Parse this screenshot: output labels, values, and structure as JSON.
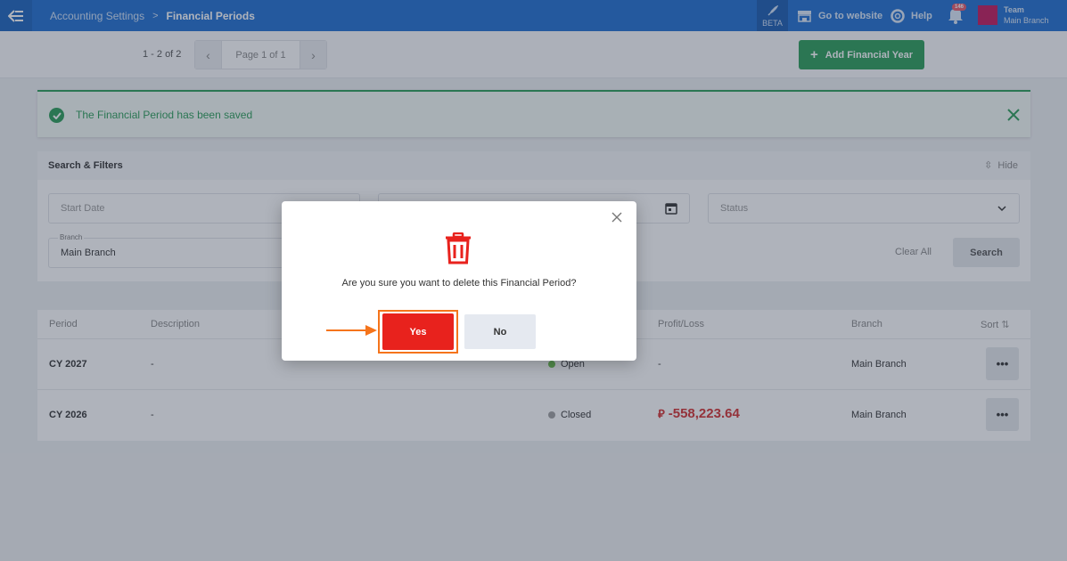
{
  "topbar": {
    "breadcrumb": [
      "Accounting Settings",
      "Financial Periods"
    ],
    "breadcrumb_sep": ">",
    "beta_label": "BETA",
    "go_to_website": "Go to website",
    "help": "Help",
    "notification_count": "146",
    "user": {
      "name": "Team",
      "branch": "Main Branch"
    }
  },
  "toolbar": {
    "record_count": "1 - 2 of 2",
    "page_label": "Page 1 of 1",
    "add_button": "Add Financial Year"
  },
  "alert": {
    "message": "The Financial Period has been saved"
  },
  "filters": {
    "title": "Search & Filters",
    "hide_label": "Hide",
    "start_date_placeholder": "Start Date",
    "status_placeholder": "Status",
    "branch_label": "Branch",
    "branch_value": "Main Branch",
    "clear_all": "Clear All",
    "search_button": "Search"
  },
  "table": {
    "columns": [
      "Period",
      "Description",
      "Profit/Loss",
      "Branch",
      "Sort"
    ],
    "rows": [
      {
        "period": "CY 2027",
        "description": "-",
        "status": "Open",
        "status_color": "#6abf4b",
        "profit_loss": "-",
        "branch": "Main Branch"
      },
      {
        "period": "CY 2026",
        "description": "-",
        "status": "Closed",
        "status_color": "#9e9e9e",
        "profit_loss": "-558,223.64",
        "currency_symbol": "⃁",
        "branch": "Main Branch"
      }
    ],
    "more_label": "•••"
  },
  "modal": {
    "question": "Are you sure you want to delete this Financial Period?",
    "yes": "Yes",
    "no": "No",
    "icon": "trash-icon"
  },
  "colors": {
    "topbar": "#1f6fd0",
    "success": "#2a9d58",
    "danger": "#e8221d",
    "highlight": "#f5741b"
  }
}
